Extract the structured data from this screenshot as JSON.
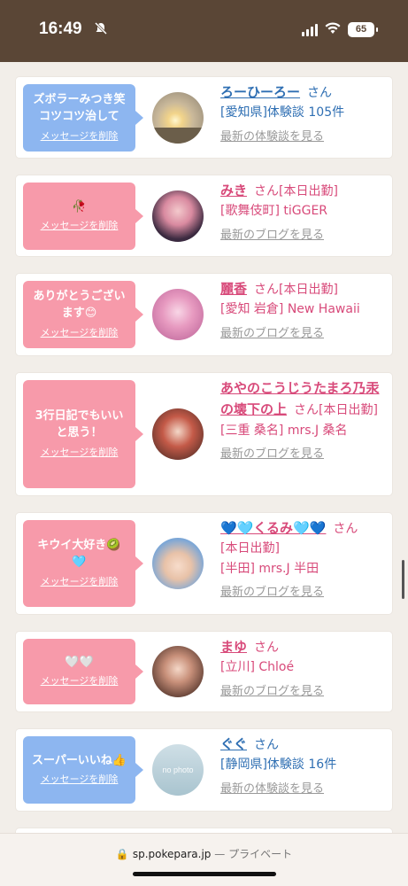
{
  "status_bar": {
    "time": "16:49",
    "battery": "65"
  },
  "cards": [
    {
      "bubble_text": "ズボラーみつき笑\nコツコツ治して",
      "bubble_color": "blue",
      "delete_label": "メッセージを削除",
      "name": "ろーひーろー",
      "san": "さん",
      "line2": "[愛知県]体験談 105件",
      "line3": "",
      "more_link": "最新の体験談を見る",
      "avatar_icon": "sunset-photo"
    },
    {
      "bubble_text": "🥀",
      "bubble_color": "pink",
      "delete_label": "メッセージを削除",
      "name": "みき",
      "san": "さん[本日出勤]",
      "line2": "[歌舞伎町] tiGGER",
      "line3": "",
      "more_link": "最新のブログを見る",
      "avatar_icon": "girl-photo"
    },
    {
      "bubble_text": "ありがとうござい\nます😊",
      "bubble_color": "pink",
      "delete_label": "メッセージを削除",
      "name": "麗香",
      "san": "さん[本日出勤]",
      "line2": "[愛知 岩倉] New Hawaii",
      "line3": "",
      "more_link": "最新のブログを見る",
      "avatar_icon": "girl-photo"
    },
    {
      "bubble_text": "3行日記でもいい\nと思う！",
      "bubble_color": "pink",
      "delete_label": "メッセージを削除",
      "name": "あやのこうじうたまろ乃汞の壊下の上",
      "san": "さん[本日出勤]",
      "line2": "[三重 桑名] mrs.J 桑名",
      "line3": "",
      "more_link": "最新のブログを見る",
      "avatar_icon": "girl-photo"
    },
    {
      "bubble_text": "キウイ大好き🥝\n🩵",
      "bubble_color": "pink",
      "delete_label": "メッセージを削除",
      "name": "💙🩵くるみ🩵💙",
      "san": "さん",
      "line2": "[本日出勤]",
      "line3": "[半田] mrs.J 半田",
      "more_link": "最新のブログを見る",
      "avatar_icon": "girl-photo"
    },
    {
      "bubble_text": "🤍🤍",
      "bubble_color": "pink",
      "delete_label": "メッセージを削除",
      "name": "まゆ",
      "san": "さん",
      "line2": "[立川] Chloé",
      "line3": "",
      "more_link": "最新のブログを見る",
      "avatar_icon": "girl-photo"
    },
    {
      "bubble_text": "スーパーいいね👍",
      "bubble_color": "blue",
      "delete_label": "メッセージを削除",
      "name": "ぐぐ",
      "san": "さん",
      "line2": "[静岡県]体験談 16件",
      "line3": "",
      "more_link": "最新の体験談を見る",
      "avatar_icon": "no-photo",
      "avatar_text": "no photo"
    }
  ],
  "url_bar": {
    "domain": "sp.pokepara.jp",
    "separator": "—",
    "mode": "プライベート"
  }
}
